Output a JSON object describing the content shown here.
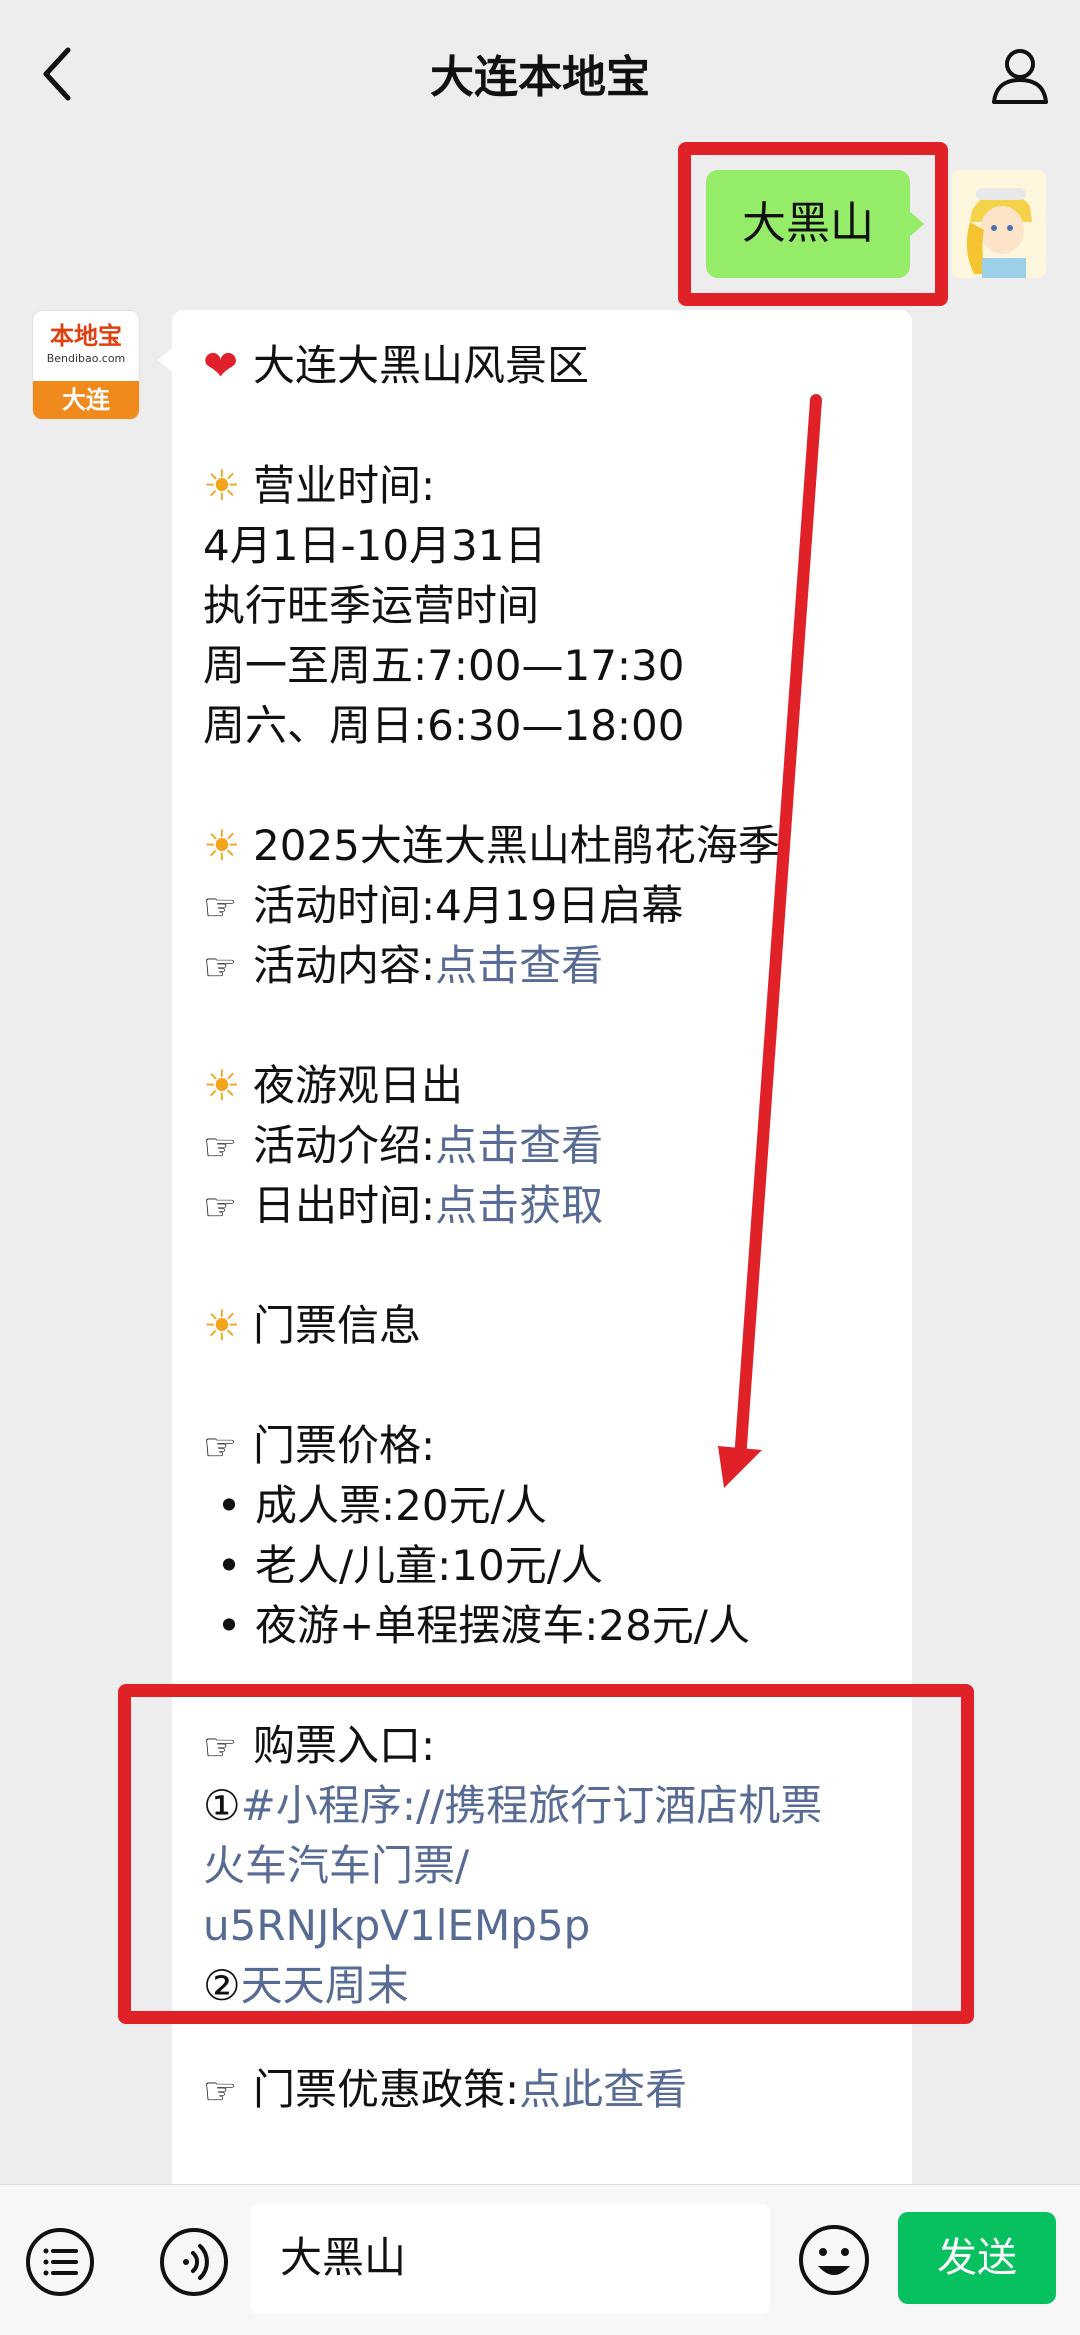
{
  "header": {
    "title": "大连本地宝"
  },
  "user_message": {
    "text": "大黑山"
  },
  "bot": {
    "logo_main": "本地宝",
    "logo_sub": "Bendibao.com",
    "logo_city": "大连"
  },
  "message": {
    "title": "大连大黑山风景区",
    "hours_heading": "营业时间:",
    "date_range": "4月1日-10月31日",
    "season_note": "执行旺季运营时间",
    "weekday_hours": "周一至周五:7:00—17:30",
    "weekend_hours": "周六、周日:6:30—18:00",
    "festival_heading": "2025大连大黑山杜鹃花海季",
    "festival_time": "活动时间:4月19日启幕",
    "festival_content_label": "活动内容:",
    "festival_content_link": "点击查看",
    "night_heading": "夜游观日出",
    "night_intro_label": "活动介绍:",
    "night_intro_link": "点击查看",
    "sunrise_label": "日出时间:",
    "sunrise_link": "点击获取",
    "ticket_heading": "门票信息",
    "price_heading": "门票价格:",
    "price_adult": "成人票:20元/人",
    "price_senior": "老人/儿童:10元/人",
    "price_night": "夜游+单程摆渡车:28元/人",
    "purchase_heading": "购票入口:",
    "purchase_num1": "①",
    "purchase_link1_line1": "#小程序://携程旅行订酒店机票",
    "purchase_link1_line2": "火车汽车门票/",
    "purchase_link1_line3": "u5RNJkpV1lEMp5p",
    "purchase_num2": "②",
    "purchase_link2": "天天周末",
    "discount_label": "门票优惠政策:",
    "discount_link": "点此查看"
  },
  "symbols": {
    "heart": "❤",
    "sun": "☀",
    "pointer": "☞",
    "bullet": "•"
  },
  "input_bar": {
    "text": "大黑山",
    "send_label": "发送"
  },
  "colors": {
    "background": "#ededed",
    "user_bubble": "#95ec69",
    "link": "#576b95",
    "send_button": "#07c160",
    "annotation_red": "#e02128"
  }
}
